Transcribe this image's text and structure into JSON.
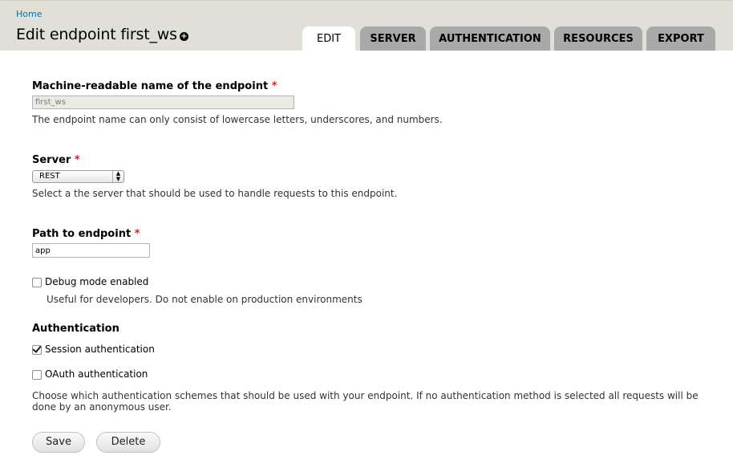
{
  "breadcrumb": {
    "home": "Home"
  },
  "page": {
    "title": "Edit endpoint first_ws",
    "shortcut_icon": "plus-circle-icon"
  },
  "tabs": [
    {
      "label": "EDIT",
      "active": true
    },
    {
      "label": "SERVER",
      "active": false
    },
    {
      "label": "AUTHENTICATION",
      "active": false
    },
    {
      "label": "RESOURCES",
      "active": false
    },
    {
      "label": "EXPORT",
      "active": false
    }
  ],
  "form": {
    "machine_name": {
      "label": "Machine-readable name of the endpoint",
      "required_mark": "*",
      "value": "first_ws",
      "description": "The endpoint name can only consist of lowercase letters, underscores, and numbers."
    },
    "server": {
      "label": "Server",
      "required_mark": "*",
      "selected": "REST",
      "description": "Select a the server that should be used to handle requests to this endpoint."
    },
    "path": {
      "label": "Path to endpoint",
      "required_mark": "*",
      "value": "app"
    },
    "debug": {
      "label": "Debug mode enabled",
      "checked": false,
      "description": "Useful for developers. Do not enable on production environments"
    },
    "authentication": {
      "title": "Authentication",
      "options": [
        {
          "label": "Session authentication",
          "checked": true
        },
        {
          "label": "OAuth authentication",
          "checked": false
        }
      ],
      "description_line1": "Choose which authentication schemes that should be used with your endpoint. If no authentication method is selected all requests will be",
      "description_line2": "done by an anonymous user."
    }
  },
  "actions": {
    "save": "Save",
    "delete": "Delete"
  },
  "colors": {
    "header_bg": "#e0e0d8",
    "tab_bg": "#a9a9a9",
    "link": "#0074bd",
    "required": "#e0201d"
  }
}
